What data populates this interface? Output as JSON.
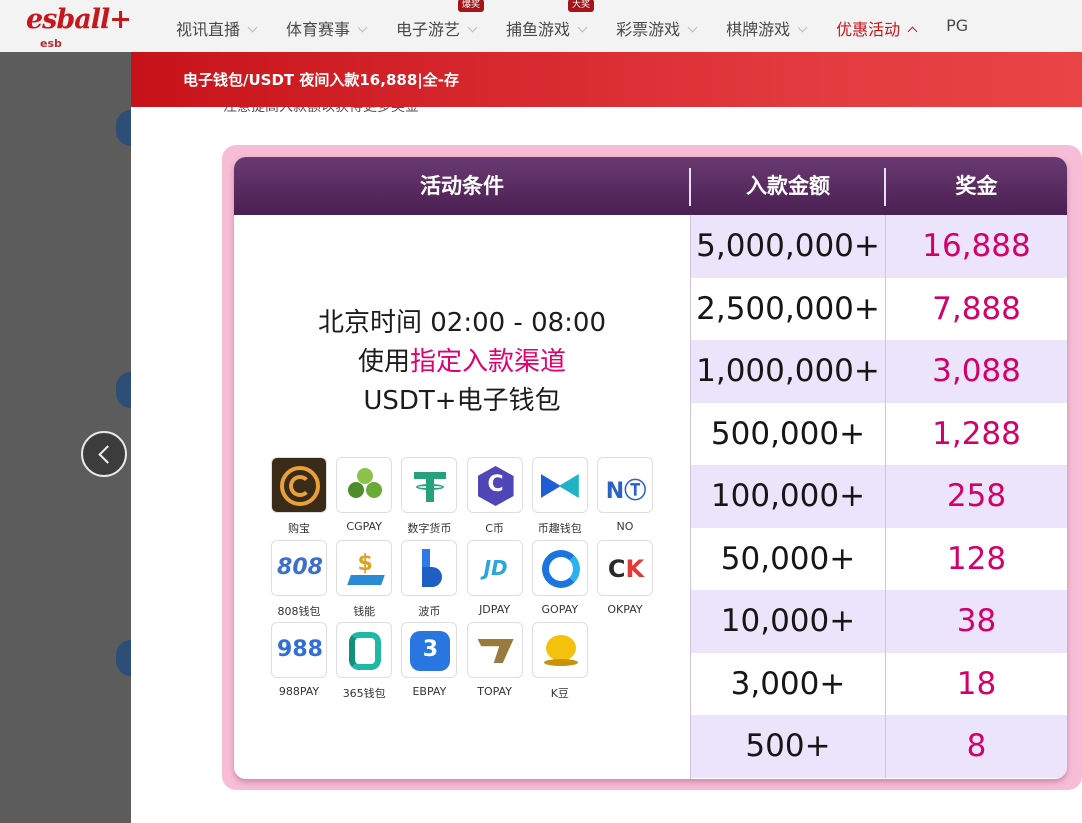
{
  "brand": {
    "logo": "esball+",
    "logo_sub": "esb"
  },
  "nav": {
    "items": [
      {
        "label": "视讯直播",
        "badge": ""
      },
      {
        "label": "体育赛事",
        "badge": ""
      },
      {
        "label": "电子游艺",
        "badge": "爆奖"
      },
      {
        "label": "捕鱼游戏",
        "badge": "大奖"
      },
      {
        "label": "彩票游戏",
        "badge": ""
      },
      {
        "label": "棋牌游戏",
        "badge": ""
      },
      {
        "label": "优惠活动",
        "badge": "",
        "active": true
      },
      {
        "label": "PG",
        "badge": ""
      }
    ]
  },
  "modal": {
    "title": "电子钱包/USDT 夜间入款16,888|全-存",
    "cut_text": "注意提高入款额以获得更多奖金"
  },
  "promo": {
    "headers": [
      "活动条件",
      "入款金额",
      "奖金"
    ],
    "condition": {
      "line1": "北京时间 02:00 - 08:00",
      "line2_pre": "使用",
      "line2_highlight": "指定入款渠道",
      "line3": "USDT+电子钱包"
    },
    "payments": [
      {
        "label": "购宝",
        "icon": "goubao-icon"
      },
      {
        "label": "CGPAY",
        "icon": "cgpay-icon"
      },
      {
        "label": "数字货币",
        "icon": "tether-icon"
      },
      {
        "label": "C币",
        "icon": "cbi-icon"
      },
      {
        "label": "币趣钱包",
        "icon": "biqu-icon"
      },
      {
        "label": "NO",
        "icon": "no-icon"
      },
      {
        "label": "808钱包",
        "icon": "808-icon"
      },
      {
        "label": "钱能",
        "icon": "qianneng-icon"
      },
      {
        "label": "波币",
        "icon": "bobi-icon"
      },
      {
        "label": "JDPAY",
        "icon": "jdpay-icon"
      },
      {
        "label": "GOPAY",
        "icon": "gopay-icon"
      },
      {
        "label": "OKPAY",
        "icon": "okpay-icon"
      },
      {
        "label": "988PAY",
        "icon": "988pay-icon"
      },
      {
        "label": "365钱包",
        "icon": "365-icon"
      },
      {
        "label": "EBPAY",
        "icon": "ebpay-icon"
      },
      {
        "label": "TOPAY",
        "icon": "topay-icon"
      },
      {
        "label": "K豆",
        "icon": "kdou-icon"
      }
    ],
    "rows": [
      {
        "amount": "5,000,000+",
        "bonus": "16,888"
      },
      {
        "amount": "2,500,000+",
        "bonus": "7,888"
      },
      {
        "amount": "1,000,000+",
        "bonus": "3,088"
      },
      {
        "amount": "500,000+",
        "bonus": "1,288"
      },
      {
        "amount": "100,000+",
        "bonus": "258"
      },
      {
        "amount": "50,000+",
        "bonus": "128"
      },
      {
        "amount": "10,000+",
        "bonus": "38"
      },
      {
        "amount": "3,000+",
        "bonus": "18"
      },
      {
        "amount": "500+",
        "bonus": "8"
      }
    ]
  },
  "colors": {
    "brand_red": "#c8161d",
    "header_purple": "#4a1f52",
    "bonus_pink": "#d4006a",
    "row_alt": "#ece4fb",
    "frame_pink": "#f7bdd6"
  }
}
